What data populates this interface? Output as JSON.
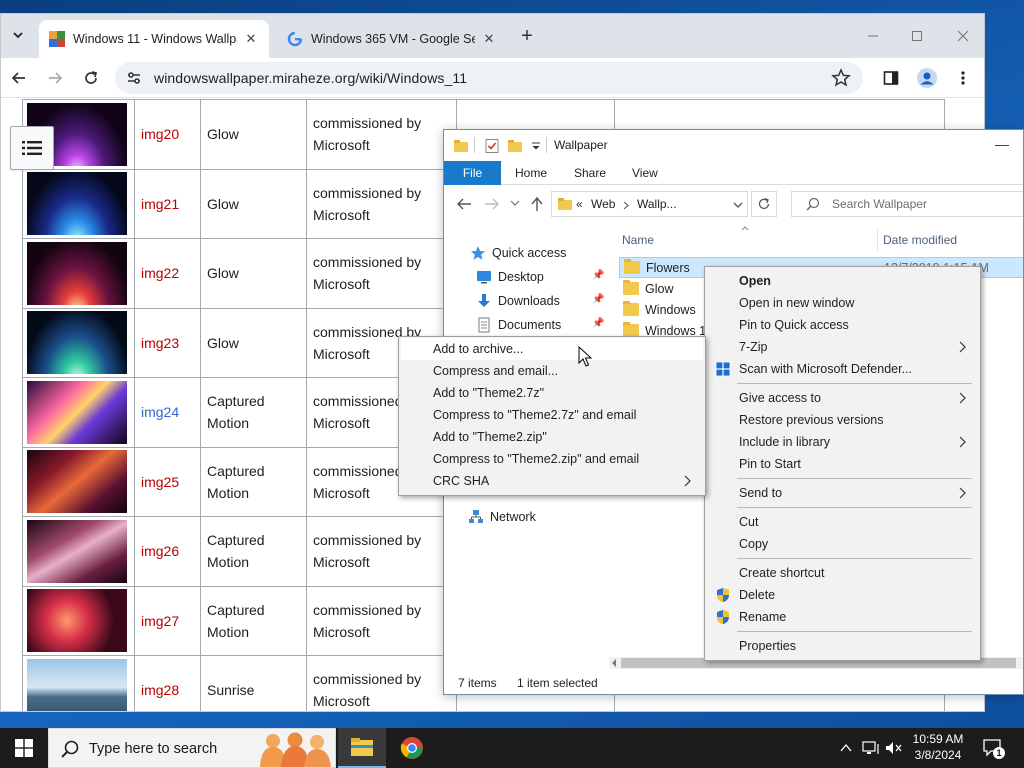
{
  "browser": {
    "tabs": [
      {
        "title": "Windows 11 - Windows Wallpa",
        "active": true
      },
      {
        "title": "Windows 365 VM - Google Sea",
        "active": false
      }
    ],
    "url": "windowswallpaper.miraheze.org/wiki/Windows_11"
  },
  "wiki": {
    "rows": [
      {
        "name": "img20",
        "style": "Glow",
        "credit": "commissioned by Microsoft",
        "link": "red"
      },
      {
        "name": "img21",
        "style": "Glow",
        "credit": "commissioned by Microsoft",
        "link": "red"
      },
      {
        "name": "img22",
        "style": "Glow",
        "credit": "commissioned by Microsoft",
        "link": "red"
      },
      {
        "name": "img23",
        "style": "Glow",
        "credit": "commissioned by Microsoft",
        "link": "red"
      },
      {
        "name": "img24",
        "style": "Captured Motion",
        "credit": "commissioned by Microsoft",
        "link": "blue"
      },
      {
        "name": "img25",
        "style": "Captured Motion",
        "credit": "commissioned by Microsoft",
        "link": "red"
      },
      {
        "name": "img26",
        "style": "Captured Motion",
        "credit": "commissioned by Microsoft",
        "link": "red"
      },
      {
        "name": "img27",
        "style": "Captured Motion",
        "credit": "commissioned by Microsoft",
        "link": "red"
      },
      {
        "name": "img28",
        "style": "Sunrise",
        "credit": "commissioned by Microsoft",
        "link": "red"
      }
    ]
  },
  "explorer": {
    "title": "Wallpaper",
    "ribbon_tabs": [
      "File",
      "Home",
      "Share",
      "View"
    ],
    "breadcrumb": {
      "prefix": "«",
      "part1": "Web",
      "part2": "Wallp..."
    },
    "search_placeholder": "Search Wallpaper",
    "nav": {
      "quick_access": "Quick access",
      "desktop": "Desktop",
      "downloads": "Downloads",
      "documents": "Documents",
      "network": "Network"
    },
    "columns": {
      "name": "Name",
      "date": "Date modified"
    },
    "files": [
      "Flowers",
      "Glow",
      "Windows",
      "Windows 10"
    ],
    "selected_file_date": "12/7/2019 1:15 AM",
    "status_items": "7 items",
    "status_selected": "1 item selected"
  },
  "context_menu": {
    "open": "Open",
    "open_new_window": "Open in new window",
    "pin_quick_access": "Pin to Quick access",
    "sevenzip": "7-Zip",
    "scan_defender": "Scan with Microsoft Defender...",
    "give_access": "Give access to",
    "restore_versions": "Restore previous versions",
    "include_library": "Include in library",
    "pin_start": "Pin to Start",
    "send_to": "Send to",
    "cut": "Cut",
    "copy": "Copy",
    "create_shortcut": "Create shortcut",
    "delete": "Delete",
    "rename": "Rename",
    "properties": "Properties"
  },
  "sevenzip_menu": {
    "add_archive": "Add to archive...",
    "compress_email": "Compress and email...",
    "add_7z": "Add to \"Theme2.7z\"",
    "compress_7z_email": "Compress to \"Theme2.7z\" and email",
    "add_zip": "Add to \"Theme2.zip\"",
    "compress_zip_email": "Compress to \"Theme2.zip\" and email",
    "crc_sha": "CRC SHA"
  },
  "taskbar": {
    "search_text": "Type here to search",
    "time": "10:59 AM",
    "date": "3/8/2024",
    "notification_count": "1"
  },
  "colors": {
    "accent": "#1979ca",
    "selection": "#cce8ff",
    "wiki_redlink": "#ba0000",
    "wiki_bluelink": "#3366cc"
  }
}
